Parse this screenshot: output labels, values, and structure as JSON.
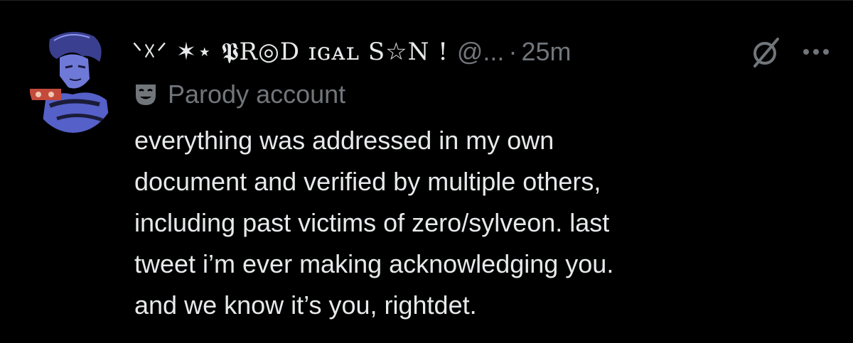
{
  "author": {
    "display_name": "ᐠ☓ᐟ ✶⋆ 𝕻R◎D ɪɢᴀʟ S☆N !",
    "handle": "@...",
    "separator": "·",
    "timestamp": "25m",
    "badge": "Parody account"
  },
  "tweet": {
    "text": "everything was addressed in my own\ndocument and verified by multiple others,\nincluding past victims of zero/sylveon. last\ntweet i’m ever making acknowledging you.\nand we know it’s you, rightdet."
  },
  "icons": {
    "grok": "grok-icon",
    "more": "more-options-icon",
    "parody": "parody-mask-icon",
    "avatar": "avatar-image"
  },
  "colors": {
    "background": "#000000",
    "primary_text": "#e7e9ea",
    "secondary_text": "#71767b",
    "avatar_accent": "#6f7ad8"
  }
}
